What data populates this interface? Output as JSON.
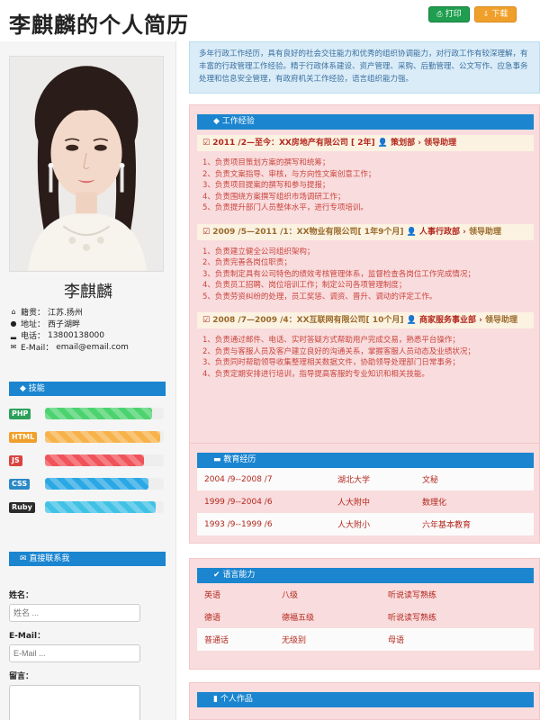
{
  "header": {
    "title": "李麒麟的个人简历",
    "print_label": "打印",
    "download_label": "下载"
  },
  "profile": {
    "name": "李麒麟",
    "info": [
      {
        "icon": "home-icon",
        "label": "籍贯：",
        "value": "江苏.扬州"
      },
      {
        "icon": "location-icon",
        "label": "地址：",
        "value": "西子湖畔"
      },
      {
        "icon": "signal-icon",
        "label": "电话：",
        "value": "13800138000"
      },
      {
        "icon": "envelope-icon",
        "label": "E-Mail：",
        "value": "email@email.com"
      }
    ]
  },
  "skills": {
    "heading": "技能",
    "items": [
      {
        "name": "PHP",
        "level": 0.9,
        "tag_color": "#2ca05a",
        "bar_color": "#4cd36f"
      },
      {
        "name": "HTML",
        "level": 0.97,
        "tag_color": "#f0a02a",
        "bar_color": "#f7b24a"
      },
      {
        "name": "JS",
        "level": 0.83,
        "tag_color": "#d9433f",
        "bar_color": "#f0535a"
      },
      {
        "name": "CSS",
        "level": 0.87,
        "tag_color": "#2a89c7",
        "bar_color": "#2aa8e4"
      },
      {
        "name": "Ruby",
        "level": 0.93,
        "tag_color": "#2b2b2b",
        "bar_color": "#41c2e5"
      }
    ]
  },
  "contact": {
    "heading": "直接联系我",
    "name_label": "姓名：",
    "name_placeholder": "姓名 ...",
    "email_label": "E-Mail：",
    "email_placeholder": "E-Mail ...",
    "message_label": "留言："
  },
  "intro": "多年行政工作经历，具有良好的社会交往能力和优秀的组织协调能力，对行政工作有较深理解，有丰富的行政管理工作经验。精于行政体系建设、资产管理、采购、后勤管理、公文写作、应急事务处理和信息安全管理，有政府机关工作经验，语言组织能力强。",
  "experience": {
    "heading": "工作经验",
    "jobs": [
      {
        "period": "2011 /2—至今：XX房地产有限公司 [ 2年]",
        "dept": "策划部",
        "role": "领导助理",
        "duties": [
          "1、负责项目策划方案的撰写和统筹；",
          "2、负责文案指导、审核，与方向性文案创意工作；",
          "3、负责项目提案的撰写和参与提报；",
          "4、负责围绕方案撰写组织市场调研工作；",
          "5、负责提升部门人员整体水平，进行专项培训。"
        ]
      },
      {
        "period": "2009 /5—2011 /1：XX物业有限公司[ 1年9个月]",
        "dept": "人事行政部",
        "role": "领导助理",
        "duties": [
          "1、负责建立健全公司组织架构；",
          "2、负责完善各岗位职责；",
          "3、负责制定具有公司特色的绩效考核管理体系，监督检查各岗位工作完成情况；",
          "4、负责员工招聘、岗位培训工作；制定公司各项管理制度；",
          "5、负责劳资纠纷的处理，员工奖惩、调资、晋升、调动的评定工作。"
        ]
      },
      {
        "period": "2008 /7—2009 /4：XX互联网有限公司[ 10个月]",
        "dept": "商家服务事业部",
        "role": "领导助理",
        "duties": [
          "1、负责通过邮件、电话、实时答疑方式帮助用户完成交易，熟悉平台操作；",
          "2、负责与客服人员及客户建立良好的沟通关系，掌握客服人员动态及业绩状况；",
          "3、负责同时帮助领导收集整理相关数据文件，协助领导处理部门日常事务；",
          "4、负责定期安排进行培训，指导提高客服的专业知识和相关技能。"
        ]
      }
    ]
  },
  "education": {
    "heading": "教育经历",
    "rows": [
      {
        "period": "2004 /9--2008 /7",
        "school": "湖北大学",
        "major": "文秘"
      },
      {
        "period": "1999 /9--2004 /6",
        "school": "人大附中",
        "major": "数理化"
      },
      {
        "period": "1993 /9--1999 /6",
        "school": "人大附小",
        "major": "六年基本教育"
      }
    ]
  },
  "languages": {
    "heading": "语言能力",
    "rows": [
      {
        "lang": "英语",
        "level": "八级",
        "skill": "听说读写熟练"
      },
      {
        "lang": "德语",
        "level": "德福五级",
        "skill": "听说读写熟练"
      },
      {
        "lang": "普通话",
        "level": "无级别",
        "skill": "母语"
      }
    ]
  },
  "works": {
    "heading": "个人作品"
  },
  "colors": {
    "accent": "#1b85d0",
    "panel_bg": "#f9dcdd",
    "intro_bg": "#d9ecf7",
    "text_red": "#b3271d"
  }
}
